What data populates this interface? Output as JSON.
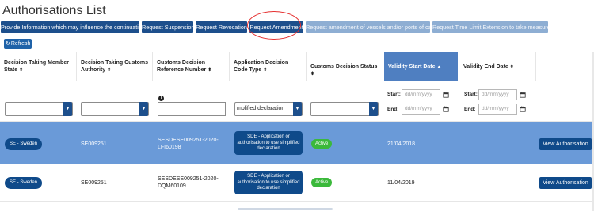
{
  "page": {
    "title": "Authorisations List"
  },
  "actions": [
    {
      "label": "Provide Information which may influence the continuation",
      "style": "dark"
    },
    {
      "label": "Request Suspension",
      "style": "dark"
    },
    {
      "label": "Request Revocation",
      "style": "dark"
    },
    {
      "label": "Request Amendment",
      "style": "dark"
    },
    {
      "label": "Request amendment of vessels and/or ports of call",
      "style": "light"
    },
    {
      "label": "Request Time Limit Extension to take measures",
      "style": "light"
    }
  ],
  "refresh": {
    "label": "Refresh",
    "icon": "refresh-icon"
  },
  "columns": [
    {
      "label": "Decision Taking Member State",
      "sort": "⬍"
    },
    {
      "label": "Decision Taking Customs Authority",
      "sort": "⬍"
    },
    {
      "label": "Customs Decision Reference Number",
      "sort": "⬍"
    },
    {
      "label": "Application Decision Code Type",
      "sort": "⬍"
    },
    {
      "label": "Customs Decision Status",
      "sort": "⬍"
    },
    {
      "label": "Validity Start Date",
      "sort": "▲"
    },
    {
      "label": "Validity End Date",
      "sort": "⬍"
    }
  ],
  "filters": {
    "code_type_value": "mplified declaration",
    "start_label": "Start:",
    "end_label": "End:",
    "date_placeholder": "dd/mm/yyyy"
  },
  "rows": [
    {
      "member_state": "SE - Sweden",
      "authority": "SE009251",
      "reference": "SESDESE009251-2020-LFI60198",
      "code_type": "SDE - Application or authorisation to use simplified declaration",
      "status": "Active",
      "start_date": "21/04/2018",
      "end_date": "",
      "action_label": "View Authorisation"
    },
    {
      "member_state": "SE - Sweden",
      "authority": "SE009251",
      "reference": "SESDESE009251-2020-DQM60109",
      "code_type": "SDE - Application or authorisation to use simplified declaration",
      "status": "Active",
      "start_date": "11/04/2019",
      "end_date": "",
      "action_label": "View Authorisation"
    }
  ],
  "colors": {
    "primary": "#1d4f8c",
    "selected_row": "#6a9ad8",
    "sorted_header": "#4f7fc1",
    "status_active": "#3bb93b",
    "annotation_circle": "#e53030"
  }
}
